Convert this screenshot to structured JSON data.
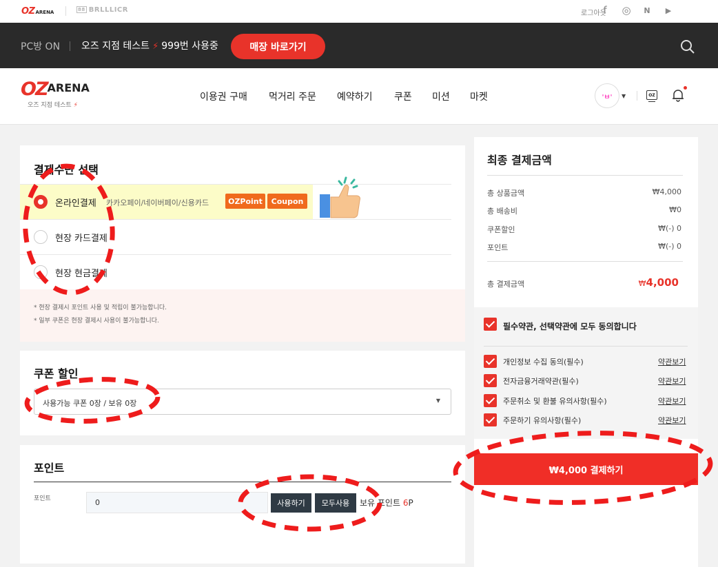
{
  "topbar": {
    "brand_oz": "OZ",
    "brand_arena": "ARENA",
    "brand_battle_box": "88",
    "brand_battle": "BRLLLICR",
    "logout": "로그아웃",
    "social_icons": [
      "facebook-icon",
      "instagram-icon",
      "naver-icon",
      "youtube-icon"
    ],
    "social_glyphs": [
      "f",
      "◎",
      "N",
      "▶"
    ]
  },
  "darkbar": {
    "pc_on": "PC방 ON",
    "store_name": "오즈 지점 테스트",
    "bolt": "⚡",
    "usage": "999번 사용중",
    "goto_store": "매장 바로가기"
  },
  "header": {
    "logo_oz": "OZ",
    "logo_arena": "ARENA",
    "logo_sub": "오즈 지점 테스트",
    "bolt": "⚡",
    "nav": [
      "이용권 구매",
      "먹거리 주문",
      "예약하기",
      "쿠폰",
      "미션",
      "마켓"
    ],
    "avatar_face": "'ㅂ'",
    "oz_badge": "OZ"
  },
  "payment": {
    "title": "결제수단 선택",
    "options": [
      {
        "label": "온라인결제",
        "desc": "카카오페이/네이버페이/신용카드",
        "selected": true
      },
      {
        "label": "현장 카드결제",
        "selected": false
      },
      {
        "label": "현장 현금결제",
        "selected": false
      }
    ],
    "tags": [
      "OZPoint",
      "Coupon"
    ],
    "notices": [
      "* 현장 결제시 포인트 사용 및 적립이 불가능합니다.",
      "* 일부 쿠폰은 현장 결제시 사용이 불가능합니다."
    ]
  },
  "coupon": {
    "title": "쿠폰 할인",
    "select_value": "사용가능 쿠폰 0장 / 보유 0장",
    "caret": "▼"
  },
  "point": {
    "title": "포인트",
    "label": "포인트",
    "input_value": "0",
    "use_button": "사용하기",
    "use_all_button": "모두사용",
    "own_label": "보유 포인트",
    "own_value": "6",
    "own_unit": "P"
  },
  "summary": {
    "title": "최종 결제금액",
    "rows": [
      {
        "label": "총 상품금액",
        "value": "₩4,000"
      },
      {
        "label": "총 배송비",
        "value": "₩0"
      },
      {
        "label": "쿠폰할인",
        "value": "₩(-) 0"
      },
      {
        "label": "포인트",
        "value": "₩(-) 0"
      }
    ],
    "total_label": "총 결제금액",
    "total_currency": "₩",
    "total_value": "4,000",
    "agree_all": "필수약관, 선택약관에 모두 동의합니다",
    "agree_items": [
      {
        "label": "개인정보 수집 동의(필수)",
        "link": "약관보기"
      },
      {
        "label": "전자금융거래약관(필수)",
        "link": "약관보기"
      },
      {
        "label": "주문취소 및 환불 유의사항(필수)",
        "link": "약관보기"
      },
      {
        "label": "주문하기 유의사항(필수)",
        "link": "약관보기"
      }
    ],
    "pay_button": "₩4,000 결제하기"
  },
  "colors": {
    "accent": "#e8332a",
    "tag_orange": "#f06a1d",
    "dark_bar": "#2a2a2a",
    "dark_button": "#2f3a44",
    "highlight": "#fcfcc8"
  }
}
